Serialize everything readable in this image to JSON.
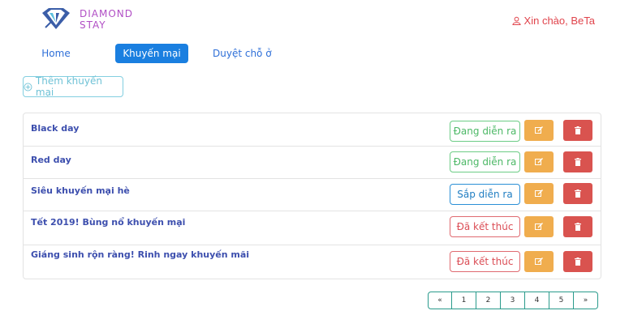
{
  "header": {
    "logo_line1": "DIAMOND",
    "logo_line2": "STAY",
    "greeting": "Xin chào, BeTa"
  },
  "nav": {
    "home": "Home",
    "promotions": "Khuyến mại",
    "approve": "Duyệt chỗ ở"
  },
  "add_button": "Thêm khuyến mại",
  "promotions": [
    {
      "title": "Black day",
      "status": "Đang diễn ra",
      "status_type": "ongoing"
    },
    {
      "title": "Red day",
      "status": "Đang diễn ra",
      "status_type": "ongoing"
    },
    {
      "title": "Siêu khuyến mại hè",
      "status": "Sắp diễn ra",
      "status_type": "upcoming"
    },
    {
      "title": "Tết 2019! Bùng nổ khuyến mại",
      "status": "Đã kết thúc",
      "status_type": "ended"
    },
    {
      "title": "Giáng sinh rộn ràng! Rinh ngay khuyến mãi",
      "status": "Đã kết thúc",
      "status_type": "ended"
    }
  ],
  "pagination": [
    "«",
    "1",
    "2",
    "3",
    "4",
    "5",
    "»"
  ],
  "colors": {
    "brand": "#b14fc5",
    "primary": "#1a7fe0",
    "warning": "#f0ad4e",
    "danger": "#d9534f",
    "success": "#4cb866"
  }
}
